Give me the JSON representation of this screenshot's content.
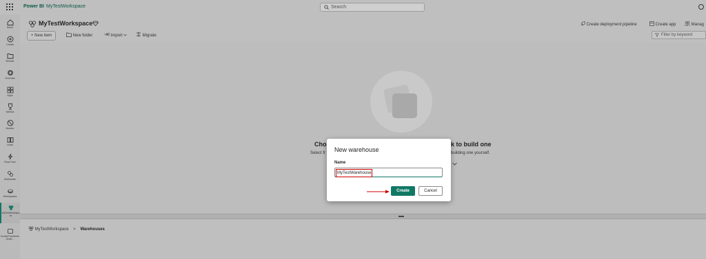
{
  "topbar": {
    "brand": "Power BI",
    "workspace_link": "MyTestWorkspace",
    "search_placeholder": "Search"
  },
  "rail": [
    {
      "label": "Home",
      "icon": "home-icon"
    },
    {
      "label": "Create",
      "icon": "plus-circle-icon"
    },
    {
      "label": "Browse",
      "icon": "folder-icon"
    },
    {
      "label": "OneLake",
      "icon": "onelake-icon"
    },
    {
      "label": "Apps",
      "icon": "apps-icon"
    },
    {
      "label": "Metrics",
      "icon": "trophy-icon"
    },
    {
      "label": "Monitor",
      "icon": "monitor-icon"
    },
    {
      "label": "Learn",
      "icon": "book-icon"
    },
    {
      "label": "Real-Time",
      "icon": "lightning-icon"
    },
    {
      "label": "Workloads",
      "icon": "workloads-icon"
    },
    {
      "label": "Workspaces",
      "icon": "workspaces-icon"
    },
    {
      "label": "MyTestWorkspace",
      "icon": "workspace-icon"
    },
    {
      "label": "InvokeTransformOrder...",
      "icon": "pipeline-icon"
    }
  ],
  "header": {
    "workspace_title": "MyTestWorkspace",
    "toolbar": {
      "new_item": "+ New item",
      "new_folder": "New folder",
      "import": "Import",
      "migrate": "Migrate"
    },
    "right": {
      "deployment": "Create deployment pipeline",
      "create_app": "Create app",
      "manage": "Manag"
    },
    "filter_placeholder": "Filter by keyword"
  },
  "empty_state": {
    "title_left": "Choo",
    "title_right": "k to build one",
    "sub_left": "Select fr",
    "sub_right": "building one yourself."
  },
  "breadcrumb": {
    "workspace": "MyTestWorkspace",
    "separator": ">",
    "current": "Warehouses"
  },
  "dialog": {
    "title": "New warehouse",
    "name_label": "Name",
    "name_value": "MyTestWarehouse",
    "create_label": "Create",
    "cancel_label": "Cancel"
  },
  "colors": {
    "accent": "#117865",
    "highlight": "#cc0000"
  }
}
